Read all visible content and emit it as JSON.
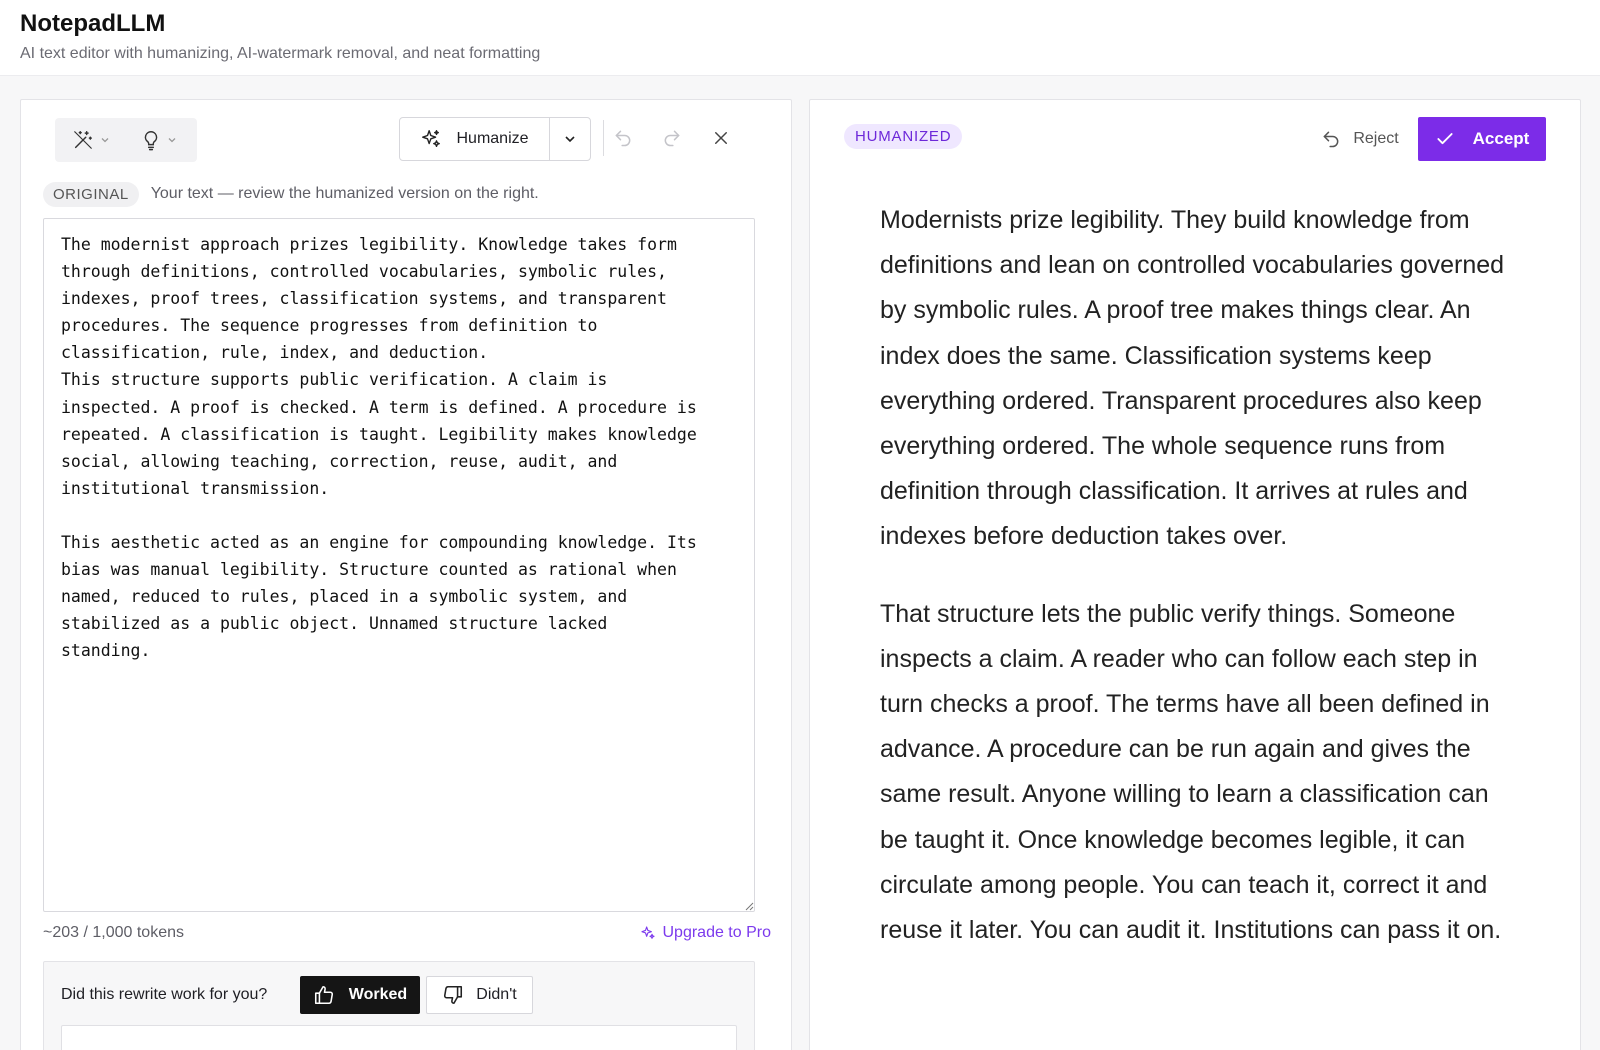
{
  "app": {
    "title": "NotepadLLM",
    "subtitle": "AI text editor with humanizing, AI-watermark removal, and neat formatting"
  },
  "toolbar": {
    "humanize_label": "Humanize"
  },
  "original": {
    "badge": "ORIGINAL",
    "hint": "Your text — review the humanized version on the right.",
    "text": "The modernist approach prizes legibility. Knowledge takes form\nthrough definitions, controlled vocabularies, symbolic rules,\nindexes, proof trees, classification systems, and transparent\nprocedures. The sequence progresses from definition to\nclassification, rule, index, and deduction.\nThis structure supports public verification. A claim is\ninspected. A proof is checked. A term is defined. A procedure is\nrepeated. A classification is taught. Legibility makes knowledge\nsocial, allowing teaching, correction, reuse, audit, and\ninstitutional transmission.\n\nThis aesthetic acted as an engine for compounding knowledge. Its\nbias was manual legibility. Structure counted as rational when\nnamed, reduced to rules, placed in a symbolic system, and\nstabilized as a public object. Unnamed structure lacked\nstanding.",
    "token_count": "~203 / 1,000 tokens",
    "upgrade_label": "Upgrade to Pro"
  },
  "feedback": {
    "question": "Did this rewrite work for you?",
    "worked_label": "Worked",
    "didnt_label": "Didn't"
  },
  "humanized": {
    "badge": "HUMANIZED",
    "reject_label": "Reject",
    "accept_label": "Accept",
    "paragraphs": [
      "Modernists prize legibility. They build knowledge from definitions and lean on controlled vocabularies governed by symbolic rules. A proof tree makes things clear. An index does the same. Classification systems keep everything ordered. Transparent procedures also keep everything ordered. The whole sequence runs from definition through classification. It arrives at rules and indexes before deduction takes over.",
      "That structure lets the public verify things. Someone inspects a claim. A reader who can follow each step in turn checks a proof. The terms have all been defined in advance. A procedure can be run again and gives the same result. Anyone willing to learn a classification can be taught it. Once knowledge becomes legible, it can circulate among people. You can teach it, correct it and reuse it later. You can audit it. Institutions can pass it on."
    ]
  },
  "colors": {
    "accent": "#7c2ce8",
    "badge_bg": "#efe7ff",
    "dark_button": "#151515"
  },
  "icons": [
    "magic-wand-icon",
    "lightbulb-icon",
    "sparkle-icon",
    "chevron-down-icon",
    "undo-icon",
    "redo-icon",
    "close-icon",
    "thumbs-up-icon",
    "thumbs-down-icon",
    "reject-undo-icon",
    "check-icon"
  ]
}
